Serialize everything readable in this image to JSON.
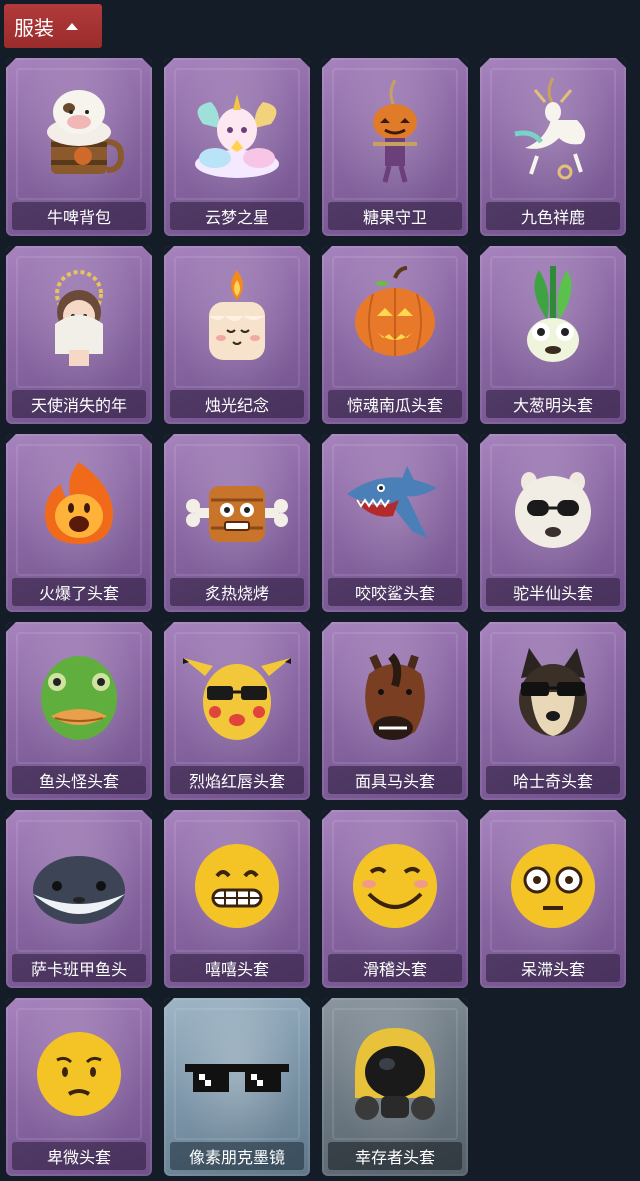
{
  "category": {
    "label": "服装",
    "icon": "chevron-up-icon",
    "color": "#b23a3a"
  },
  "items": [
    {
      "name": "牛啤背包",
      "theme": "purple",
      "icon": "cow-beer-mug-icon"
    },
    {
      "name": "云梦之星",
      "theme": "purple",
      "icon": "unicorn-cloud-icon"
    },
    {
      "name": "糖果守卫",
      "theme": "purple",
      "icon": "pumpkin-scarecrow-icon"
    },
    {
      "name": "九色祥鹿",
      "theme": "purple",
      "icon": "deer-charm-icon"
    },
    {
      "name": "天使消失的年",
      "theme": "purple",
      "icon": "angel-doll-icon"
    },
    {
      "name": "烛光纪念",
      "theme": "purple",
      "icon": "candle-icon"
    },
    {
      "name": "惊魂南瓜头套",
      "theme": "purple",
      "icon": "jack-o-lantern-icon"
    },
    {
      "name": "大葱明头套",
      "theme": "purple",
      "icon": "scallion-head-icon"
    },
    {
      "name": "火爆了头套",
      "theme": "purple",
      "icon": "fireball-head-icon"
    },
    {
      "name": "炙热烧烤",
      "theme": "purple",
      "icon": "bbq-meat-icon"
    },
    {
      "name": "咬咬鲨头套",
      "theme": "purple",
      "icon": "shark-head-icon"
    },
    {
      "name": "驼半仙头套",
      "theme": "purple",
      "icon": "alpaca-sunglasses-icon"
    },
    {
      "name": "鱼头怪头套",
      "theme": "purple",
      "icon": "fish-man-head-icon"
    },
    {
      "name": "烈焰红唇头套",
      "theme": "purple",
      "icon": "yellow-mascot-head-icon"
    },
    {
      "name": "面具马头套",
      "theme": "purple",
      "icon": "horse-mask-icon"
    },
    {
      "name": "哈士奇头套",
      "theme": "purple",
      "icon": "husky-sunglasses-icon"
    },
    {
      "name": "萨卡班甲鱼头",
      "theme": "purple",
      "icon": "round-fish-head-icon"
    },
    {
      "name": "嘻嘻头套",
      "theme": "purple",
      "icon": "grin-emoji-icon"
    },
    {
      "name": "滑稽头套",
      "theme": "purple",
      "icon": "silly-emoji-icon"
    },
    {
      "name": "呆滞头套",
      "theme": "purple",
      "icon": "stare-emoji-icon"
    },
    {
      "name": "卑微头套",
      "theme": "purple",
      "icon": "humble-emoji-icon"
    },
    {
      "name": "像素朋克墨镜",
      "theme": "blue",
      "icon": "pixel-sunglasses-icon"
    },
    {
      "name": "幸存者头套",
      "theme": "grey",
      "icon": "gas-mask-helmet-icon"
    }
  ]
}
